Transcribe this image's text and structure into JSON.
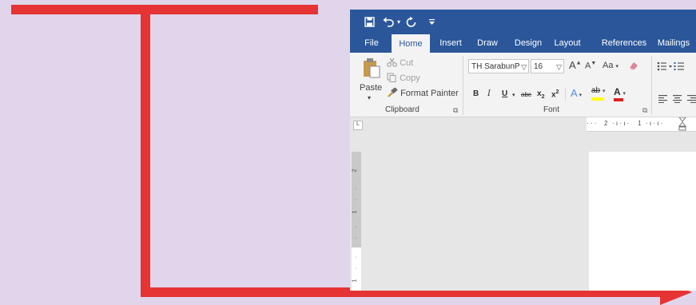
{
  "quick_access": {
    "save_icon": "save-icon",
    "undo_icon": "undo-icon",
    "redo_icon": "redo-icon",
    "customize_icon": "customize-qat-icon"
  },
  "tabs": [
    {
      "label": "File",
      "active": false
    },
    {
      "label": "Home",
      "active": true
    },
    {
      "label": "Insert",
      "active": false
    },
    {
      "label": "Draw",
      "active": false
    },
    {
      "label": "Design",
      "active": false
    },
    {
      "label": "Layout",
      "active": false
    },
    {
      "label": "References",
      "active": false
    },
    {
      "label": "Mailings",
      "active": false
    }
  ],
  "clipboard": {
    "paste": "Paste",
    "cut": "Cut",
    "copy": "Copy",
    "format_painter": "Format Painter",
    "group_label": "Clipboard"
  },
  "font": {
    "font_name": "TH SarabunP",
    "font_size": "16",
    "grow": "A",
    "shrink": "A",
    "change_case": "Aa",
    "bold": "B",
    "italic": "I",
    "underline": "U",
    "strikethrough": "abc",
    "subscript": "x",
    "superscript": "x",
    "text_effects": "A",
    "highlight": "ab",
    "font_color": "A",
    "group_label": "Font"
  },
  "ruler": {
    "horizontal_labels": [
      "2",
      "1"
    ],
    "vertical_labels": [
      "2",
      "1",
      "1"
    ]
  },
  "colors": {
    "accent": "#2b579a",
    "annotation": "#e63333",
    "background": "#e0d5ea"
  }
}
